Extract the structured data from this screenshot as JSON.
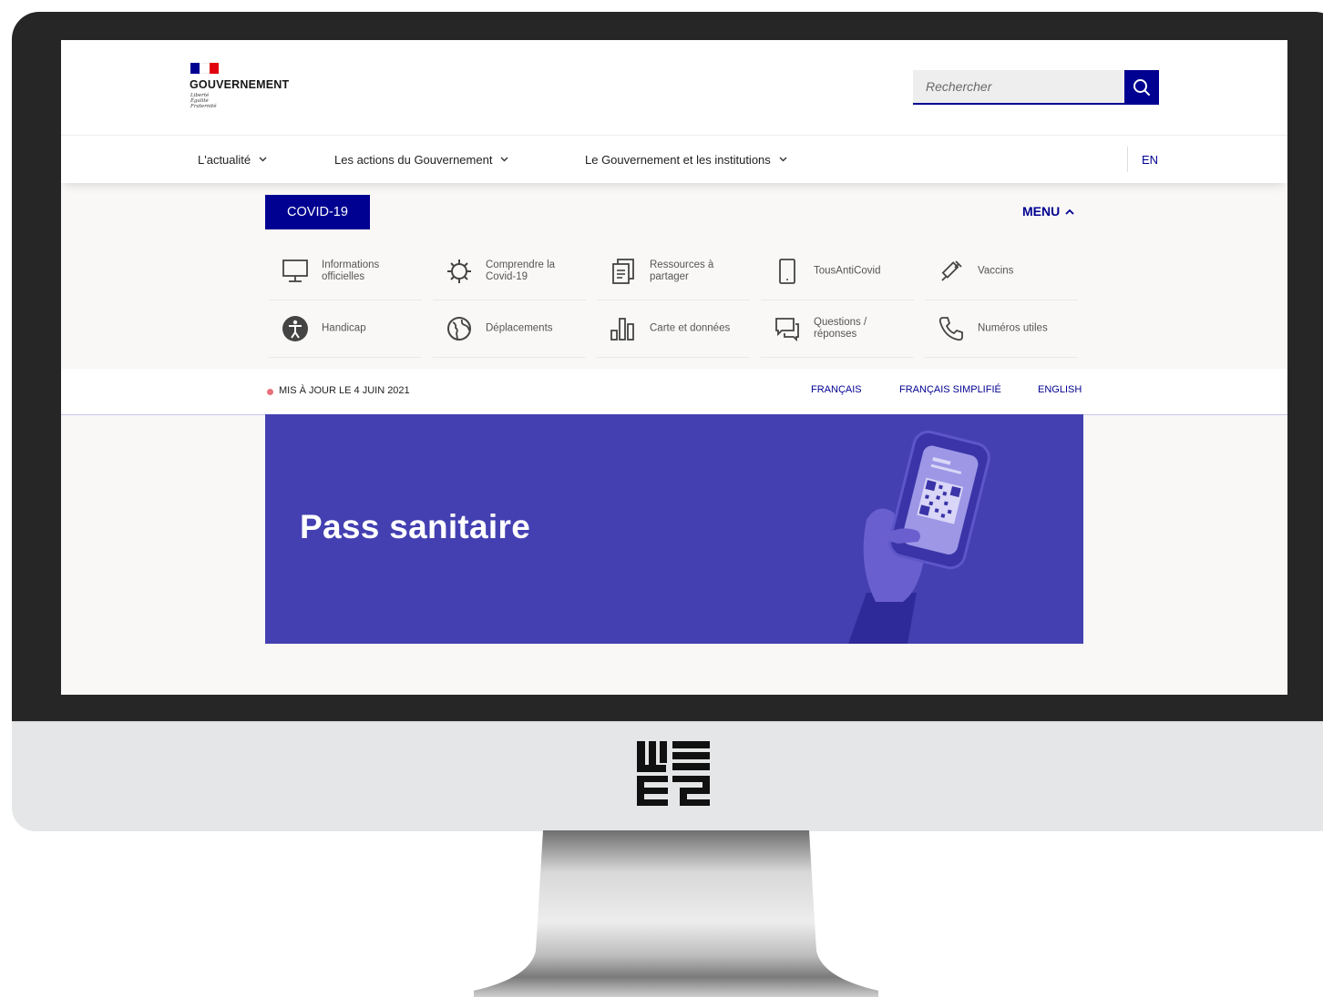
{
  "header": {
    "logo_title": "GOUVERNEMENT",
    "motto": [
      "Liberté",
      "Égalité",
      "Fraternité"
    ],
    "search_placeholder": "Rechercher"
  },
  "nav": {
    "items": [
      {
        "label": "L'actualité"
      },
      {
        "label": "Les actions du Gouvernement"
      },
      {
        "label": "Le Gouvernement et les institutions"
      }
    ],
    "lang_switch": "EN"
  },
  "covid_menu": {
    "button_label": "COVID-19",
    "menu_label": "MENU",
    "tiles": [
      {
        "label": "Informations officielles",
        "icon": "monitor-icon"
      },
      {
        "label": "Comprendre la Covid-19",
        "icon": "virus-icon"
      },
      {
        "label": "Ressources à partager",
        "icon": "documents-icon"
      },
      {
        "label": "TousAntiCovid",
        "icon": "smartphone-icon"
      },
      {
        "label": "Vaccins",
        "icon": "syringe-icon"
      },
      {
        "label": "Handicap",
        "icon": "accessibility-icon"
      },
      {
        "label": "Déplacements",
        "icon": "globe-icon"
      },
      {
        "label": "Carte et données",
        "icon": "bar-chart-icon"
      },
      {
        "label": "Questions / réponses",
        "icon": "chat-icon"
      },
      {
        "label": "Numéros utiles",
        "icon": "phone-icon"
      }
    ]
  },
  "update_bar": {
    "update_text": "MIS À JOUR LE 4 JUIN 2021",
    "languages": [
      "FRANÇAIS",
      "FRANÇAIS SIMPLIFIÉ",
      "ENGLISH"
    ]
  },
  "banner": {
    "title": "Pass sanitaire"
  },
  "colors": {
    "primary_blue": "#000091",
    "banner_blue": "#4440b2",
    "flag_red": "#e1000f",
    "update_dot": "#e8707a"
  }
}
